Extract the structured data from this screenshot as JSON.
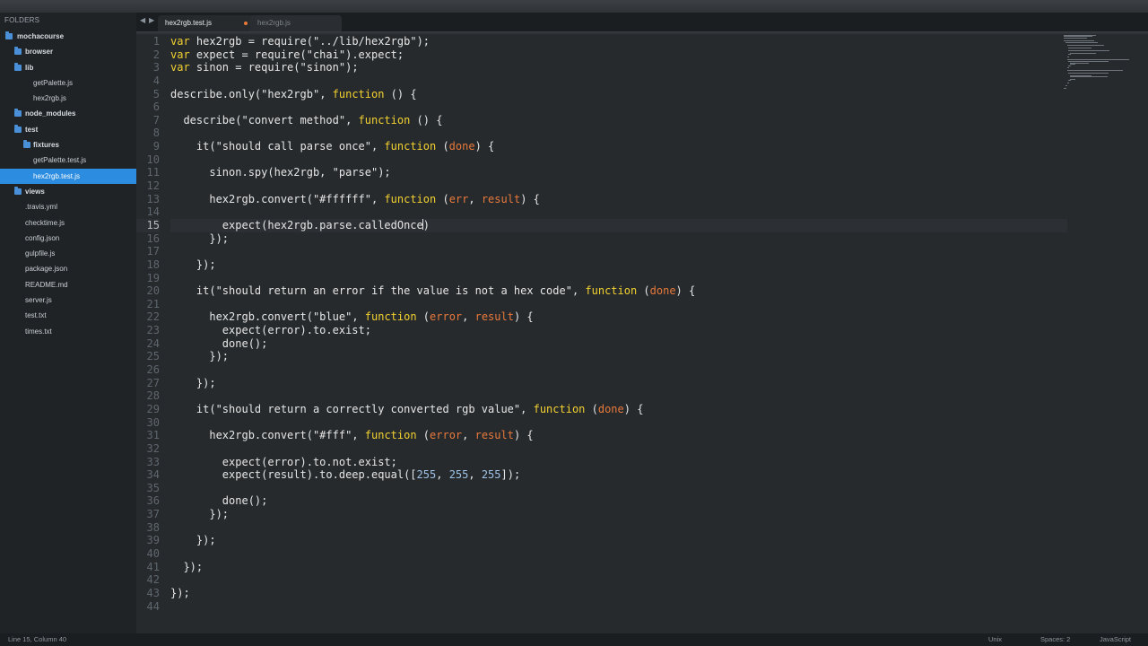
{
  "sidebar": {
    "header": "FOLDERS",
    "tree": [
      {
        "label": "mochacourse",
        "depth": 0,
        "folder": true,
        "selected": false
      },
      {
        "label": "browser",
        "depth": 1,
        "folder": true,
        "selected": false
      },
      {
        "label": "lib",
        "depth": 1,
        "folder": true,
        "selected": false
      },
      {
        "label": "getPalette.js",
        "depth": 2,
        "folder": false,
        "selected": false
      },
      {
        "label": "hex2rgb.js",
        "depth": 2,
        "folder": false,
        "selected": false
      },
      {
        "label": "node_modules",
        "depth": 1,
        "folder": true,
        "selected": false
      },
      {
        "label": "test",
        "depth": 1,
        "folder": true,
        "selected": false
      },
      {
        "label": "fixtures",
        "depth": 2,
        "folder": true,
        "selected": false
      },
      {
        "label": "getPalette.test.js",
        "depth": 2,
        "folder": false,
        "selected": false
      },
      {
        "label": "hex2rgb.test.js",
        "depth": 2,
        "folder": false,
        "selected": true
      },
      {
        "label": "views",
        "depth": 1,
        "folder": true,
        "selected": false
      },
      {
        "label": ".travis.yml",
        "depth": 1,
        "folder": false,
        "selected": false
      },
      {
        "label": "checktime.js",
        "depth": 1,
        "folder": false,
        "selected": false
      },
      {
        "label": "config.json",
        "depth": 1,
        "folder": false,
        "selected": false
      },
      {
        "label": "gulpfile.js",
        "depth": 1,
        "folder": false,
        "selected": false
      },
      {
        "label": "package.json",
        "depth": 1,
        "folder": false,
        "selected": false
      },
      {
        "label": "README.md",
        "depth": 1,
        "folder": false,
        "selected": false
      },
      {
        "label": "server.js",
        "depth": 1,
        "folder": false,
        "selected": false
      },
      {
        "label": "test.txt",
        "depth": 1,
        "folder": false,
        "selected": false
      },
      {
        "label": "times.txt",
        "depth": 1,
        "folder": false,
        "selected": false
      }
    ]
  },
  "tabs": [
    {
      "label": "hex2rgb.test.js",
      "active": true,
      "dirty": true
    },
    {
      "label": "hex2rgb.js",
      "active": false,
      "dirty": false
    }
  ],
  "editor": {
    "current_line": 15,
    "cursor_column": 40,
    "lines": [
      "var hex2rgb = require(\"../lib/hex2rgb\");",
      "var expect = require(\"chai\").expect;",
      "var sinon = require(\"sinon\");",
      "",
      "describe.only(\"hex2rgb\", function () {",
      "",
      "  describe(\"convert method\", function () {",
      "",
      "    it(\"should call parse once\", function (done) {",
      "",
      "      sinon.spy(hex2rgb, \"parse\");",
      "",
      "      hex2rgb.convert(\"#ffffff\", function (err, result) {",
      "",
      "        expect(hex2rgb.parse.calledOnce)",
      "      });",
      "",
      "    });",
      "",
      "    it(\"should return an error if the value is not a hex code\", function (done) {",
      "",
      "      hex2rgb.convert(\"blue\", function (error, result) {",
      "        expect(error).to.exist;",
      "        done();",
      "      });",
      "",
      "    });",
      "",
      "    it(\"should return a correctly converted rgb value\", function (done) {",
      "",
      "      hex2rgb.convert(\"#fff\", function (error, result) {",
      "",
      "        expect(error).to.not.exist;",
      "        expect(result).to.deep.equal([255, 255, 255]);",
      "",
      "        done();",
      "      });",
      "",
      "    });",
      "",
      "  });",
      "",
      "});",
      ""
    ]
  },
  "statusbar": {
    "position": "Line 15, Column 40",
    "line_endings": "Unix",
    "indentation": "Spaces: 2",
    "syntax": "JavaScript"
  },
  "colors": {
    "keyword": "#f2d130",
    "string": "#e6e6e6",
    "param": "#e8793b",
    "number": "#9ec3e6",
    "selection": "#2b8ce0"
  }
}
